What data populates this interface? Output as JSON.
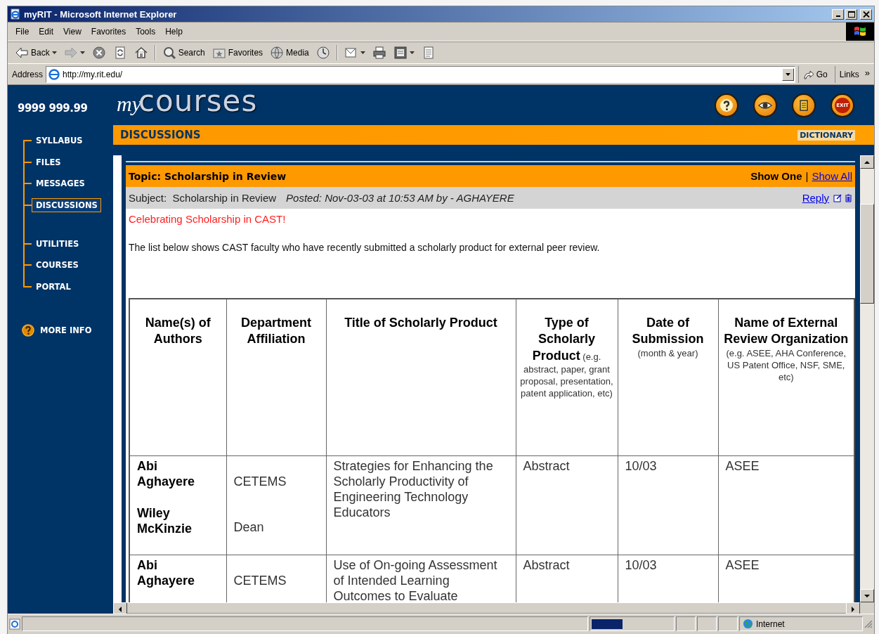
{
  "window": {
    "title": "myRIT - Microsoft Internet Explorer"
  },
  "menu": [
    "File",
    "Edit",
    "View",
    "Favorites",
    "Tools",
    "Help"
  ],
  "toolbar": [
    {
      "kind": "back",
      "label": "Back"
    },
    {
      "kind": "forward"
    },
    {
      "kind": "stop"
    },
    {
      "kind": "refresh"
    },
    {
      "kind": "home"
    },
    {
      "kind": "search",
      "label": "Search"
    },
    {
      "kind": "favorites",
      "label": "Favorites"
    },
    {
      "kind": "media",
      "label": "Media"
    },
    {
      "kind": "history"
    },
    {
      "kind": "mail"
    },
    {
      "kind": "print"
    },
    {
      "kind": "word"
    },
    {
      "kind": "edit"
    }
  ],
  "address": {
    "label": "Address",
    "value": "http://my.rit.edu/",
    "go": "Go",
    "links": "Links",
    "more": "»"
  },
  "site": {
    "account": "9999 999.99",
    "logo": {
      "script": "my",
      "name": "courses"
    },
    "header_buttons": [
      {
        "kind": "help"
      },
      {
        "kind": "view"
      },
      {
        "kind": "notes"
      },
      {
        "kind": "exit",
        "label": "EXIT"
      }
    ],
    "section": "DISCUSSIONS",
    "dictionary": "DICTIONARY",
    "nav_groups": [
      [
        {
          "label": "SYLLABUS",
          "selected": false
        },
        {
          "label": "FILES",
          "selected": false
        },
        {
          "label": "MESSAGES",
          "selected": false
        },
        {
          "label": "DISCUSSIONS",
          "selected": true
        }
      ],
      [
        {
          "label": "UTILITIES",
          "selected": false
        },
        {
          "label": "COURSES",
          "selected": false
        },
        {
          "label": "PORTAL",
          "selected": false
        }
      ]
    ],
    "more_info": "MORE INFO"
  },
  "post": {
    "topic": "Topic: Scholarship in Review",
    "views": [
      {
        "label": "Show One",
        "selected": true
      },
      {
        "label": "Show All",
        "selected": false
      }
    ],
    "view_separator": "|",
    "subject": "Subject:  Scholarship in Review",
    "posted": "Posted: Nov-03-03 at 10:53 AM by - AGHAYERE",
    "reply": "Reply",
    "headline": "Celebrating Scholarship in CAST!",
    "body": "The list below shows CAST faculty who have recently submitted a scholarly product for external peer review."
  },
  "table": {
    "columns": [
      {
        "kind": "title",
        "heading": "Name(s) of Authors"
      },
      {
        "kind": "title",
        "heading": "Department Affiliation"
      },
      {
        "kind": "title",
        "heading": "Title of Scholarly Product"
      },
      {
        "kind": "annotated",
        "heading": "**Type of Scholarly Product** (e.g. abstract, paper, grant proposal, presentation, patent application, etc)"
      },
      {
        "kind": "annotated",
        "heading": "**Date of Submission** (month & year)"
      },
      {
        "kind": "annotated",
        "heading": "**Name of External Review Organization** (e.g. ASEE, AHA Conference, US Patent Office, NSF, SME, etc)"
      }
    ],
    "rows": [
      {
        "authors": [
          "Abi Aghayere",
          "Wiley McKinzie"
        ],
        "departments": [
          "CETEMS",
          "Dean"
        ],
        "title": "Strategies for Enhancing the Scholarly Productivity of Engineering Technology Educators",
        "type": "Abstract",
        "date": "10/03",
        "organization": "ASEE"
      },
      {
        "authors": [
          "Abi Aghayere"
        ],
        "departments": [
          "CETEMS"
        ],
        "title": "Use of On-going Assessment of Intended Learning Outcomes to Evaluate",
        "type": "Abstract",
        "date": "10/03",
        "organization": "ASEE"
      }
    ]
  },
  "status_bar": {
    "progress": {
      "level": 0.38
    },
    "zone": "Internet"
  }
}
